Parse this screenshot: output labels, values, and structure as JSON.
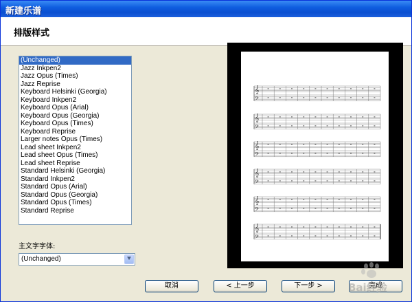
{
  "window": {
    "title": "新建乐谱"
  },
  "header": {
    "title": "排版样式"
  },
  "styles": {
    "items": [
      "(Unchanged)",
      "Jazz Inkpen2",
      "Jazz Opus (Times)",
      "Jazz Reprise",
      "Keyboard Helsinki (Georgia)",
      "Keyboard Inkpen2",
      "Keyboard Opus (Arial)",
      "Keyboard Opus (Georgia)",
      "Keyboard Opus (Times)",
      "Keyboard Reprise",
      "Larger notes Opus (Times)",
      "Lead sheet Inkpen2",
      "Lead sheet Opus (Times)",
      "Lead sheet Reprise",
      "Standard Helsinki (Georgia)",
      "Standard Inkpen2",
      "Standard Opus (Arial)",
      "Standard Opus (Georgia)",
      "Standard Opus (Times)",
      "Standard Reprise"
    ],
    "selected_index": 0
  },
  "font": {
    "label": "主文字字体:",
    "value": "(Unchanged)"
  },
  "buttons": {
    "cancel": "取消",
    "back": "< 上一步",
    "next": "下一步 >",
    "finish": "完成"
  },
  "watermark": {
    "text": "Bai经验"
  },
  "colors": {
    "title_bar": "#0a4fd0",
    "selection": "#316ac5",
    "dialog_bg": "#ece9d8"
  }
}
